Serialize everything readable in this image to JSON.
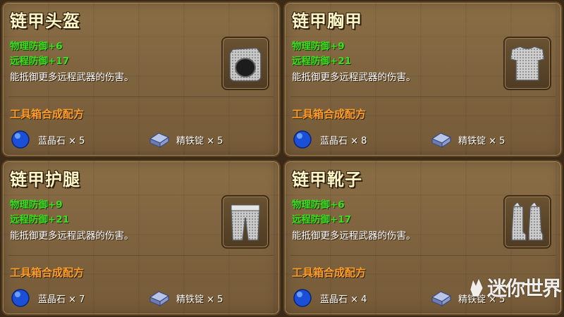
{
  "cards": [
    {
      "title": "链甲头盔",
      "stat_physical": "物理防御+6",
      "stat_ranged": "远程防御+17",
      "description": "能抵御更多远程武器的伤害。",
      "recipe_title": "工具箱合成配方",
      "materials": [
        {
          "label": "蓝晶石 × 5",
          "icon": "blue-crystal-icon"
        },
        {
          "label": "精铁锭 × 5",
          "icon": "iron-ingot-icon"
        }
      ],
      "item_icon": "chainmail-helmet-icon"
    },
    {
      "title": "链甲胸甲",
      "stat_physical": "物理防御+9",
      "stat_ranged": "远程防御+21",
      "description": "能抵御更多远程武器的伤害。",
      "recipe_title": "工具箱合成配方",
      "materials": [
        {
          "label": "蓝晶石 × 8",
          "icon": "blue-crystal-icon"
        },
        {
          "label": "精铁锭 × 5",
          "icon": "iron-ingot-icon"
        }
      ],
      "item_icon": "chainmail-chestplate-icon"
    },
    {
      "title": "链甲护腿",
      "stat_physical": "物理防御+9",
      "stat_ranged": "远程防御+21",
      "description": "能抵御更多远程武器的伤害。",
      "recipe_title": "工具箱合成配方",
      "materials": [
        {
          "label": "蓝晶石 × 7",
          "icon": "blue-crystal-icon"
        },
        {
          "label": "精铁锭 × 5",
          "icon": "iron-ingot-icon"
        }
      ],
      "item_icon": "chainmail-leggings-icon"
    },
    {
      "title": "链甲靴子",
      "stat_physical": "物理防御+6",
      "stat_ranged": "远程防御+17",
      "description": "能抵御更多远程武器的伤害。",
      "recipe_title": "工具箱合成配方",
      "materials": [
        {
          "label": "蓝晶石 × 4",
          "icon": "blue-crystal-icon"
        },
        {
          "label": "精铁锭 × 5",
          "icon": "iron-ingot-icon"
        }
      ],
      "item_icon": "chainmail-boots-icon"
    }
  ],
  "watermark": {
    "text": "迷你世界",
    "icon": "mini-world-logo-icon"
  },
  "colors": {
    "title": "#fff6c8",
    "stat": "#39e21c",
    "recipe_title": "#ff9e2a",
    "panel": "#7f6440"
  }
}
